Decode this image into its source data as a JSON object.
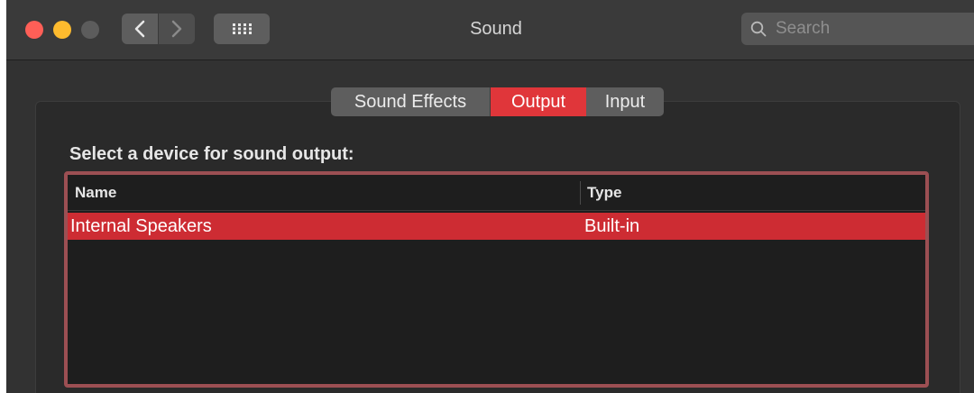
{
  "window": {
    "title": "Sound",
    "traffic_lights": {
      "close": "#fe5f57",
      "minimize": "#febb2e",
      "zoom": "#5c5c5c"
    },
    "nav": {
      "back_icon": "chevron-left-icon",
      "forward_icon": "chevron-right-icon",
      "grid_icon": "grid-icon"
    },
    "search": {
      "placeholder": "Search",
      "value": "",
      "icon": "search-icon"
    }
  },
  "tabs": [
    {
      "label": "Sound Effects",
      "selected": false
    },
    {
      "label": "Output",
      "selected": true
    },
    {
      "label": "Input",
      "selected": false
    }
  ],
  "output": {
    "heading": "Select a device for sound output:",
    "columns": [
      "Name",
      "Type"
    ],
    "rows": [
      {
        "name": "Internal Speakers",
        "type": "Built-in",
        "selected": true
      }
    ]
  },
  "colors": {
    "accent": "#e0363a",
    "selected_row": "#cd2c33",
    "focus_ring": "#9c4f53",
    "background": "#323232"
  }
}
